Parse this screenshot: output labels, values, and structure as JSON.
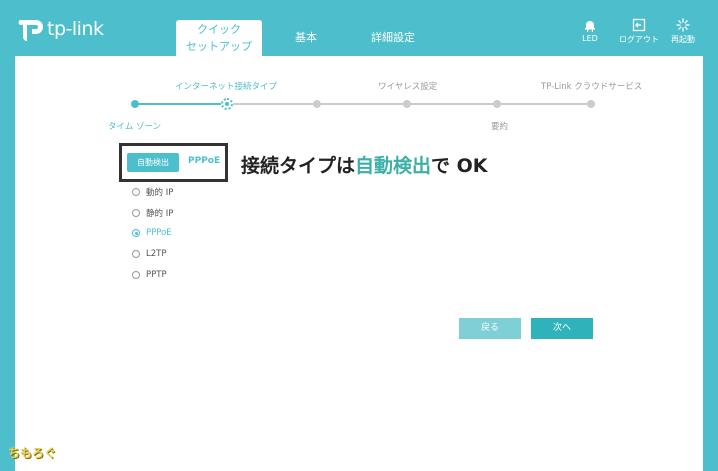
{
  "brand": {
    "name": "tp-link"
  },
  "nav": {
    "quick_setup_line1": "クイック",
    "quick_setup_line2": "セットアップ",
    "basic": "基本",
    "advanced": "詳細設定"
  },
  "header_buttons": {
    "led": "LED",
    "logout": "ログアウト",
    "reboot": "再起動"
  },
  "progress": {
    "steps_top": [
      "インターネット接続タイプ",
      "ワイヤレス設定",
      "TP-Link クラウドサービス"
    ],
    "steps_bottom": [
      "タイム ゾーン",
      "要約"
    ]
  },
  "detect": {
    "button_label": "自動検出",
    "result": "PPPoE"
  },
  "annotation": {
    "prefix": "接続タイプは",
    "highlight": "自動検出",
    "suffix": "で OK"
  },
  "connection_types": [
    {
      "label": "動的 IP",
      "selected": false
    },
    {
      "label": "静的 IP",
      "selected": false
    },
    {
      "label": "PPPoE",
      "selected": true
    },
    {
      "label": "L2TP",
      "selected": false
    },
    {
      "label": "PPTP",
      "selected": false
    }
  ],
  "buttons": {
    "back": "戻る",
    "next": "次へ"
  },
  "watermark": "ちもろぐ",
  "colors": {
    "accent": "#4dbfcc",
    "annotation_highlight": "#3cb0a8"
  }
}
